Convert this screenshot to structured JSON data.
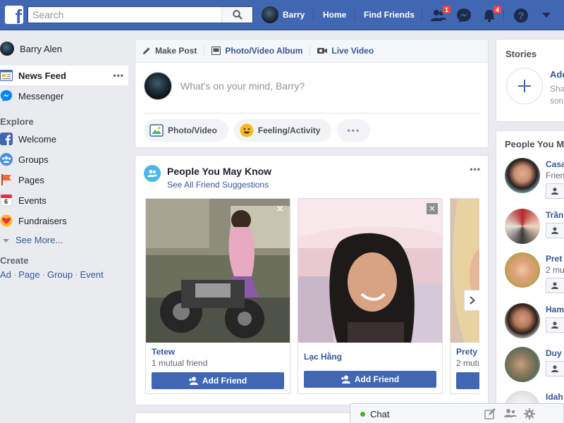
{
  "topbar": {
    "logo": "f",
    "search_placeholder": "Search",
    "user_name": "Barry",
    "home": "Home",
    "find_friends": "Find Friends",
    "friend_requests_badge": "1",
    "notifications_badge": "4",
    "help": "?",
    "brand_color": "#4267b2"
  },
  "leftnav": {
    "profile_name": "Barry Alen",
    "news_feed": "News Feed",
    "messenger": "Messenger",
    "explore_heading": "Explore",
    "explore_items": [
      "Welcome",
      "Groups",
      "Pages",
      "Events",
      "Fundraisers"
    ],
    "events_day": "6",
    "see_more": "See More...",
    "create_heading": "Create",
    "create_links": [
      "Ad",
      "Page",
      "Group",
      "Event"
    ],
    "more_dots": "•••"
  },
  "composer": {
    "tabs": [
      "Make Post",
      "Photo/Video Album",
      "Live Video"
    ],
    "placeholder": "What's on your mind, Barry?",
    "actions": [
      "Photo/Video",
      "Feeling/Activity"
    ],
    "more": "•••"
  },
  "pymk": {
    "title": "People You May Know",
    "subtitle": "See All Friend Suggestions",
    "more": "•••",
    "add_friend_label": "Add Friend",
    "people": [
      {
        "name": "Tetew",
        "mutual": "1 mutual friend"
      },
      {
        "name": "Lạc Hằng",
        "mutual": ""
      },
      {
        "name": "Prety",
        "mutual": "2 mutu"
      }
    ]
  },
  "stories": {
    "title": "Stories",
    "add_label": "Add",
    "share_line1": "Sha",
    "share_line2": "son"
  },
  "right_pymk": {
    "title": "People You M",
    "people": [
      {
        "name": "Casa",
        "sub": "Frien"
      },
      {
        "name": "Trần",
        "sub": ""
      },
      {
        "name": "Pret",
        "sub": "2 mu"
      },
      {
        "name": "Ham",
        "sub": ""
      },
      {
        "name": "Duy",
        "sub": ""
      },
      {
        "name": "Idah",
        "sub": ""
      }
    ]
  },
  "chat": {
    "label": "Chat",
    "online_color": "#42b72a"
  }
}
